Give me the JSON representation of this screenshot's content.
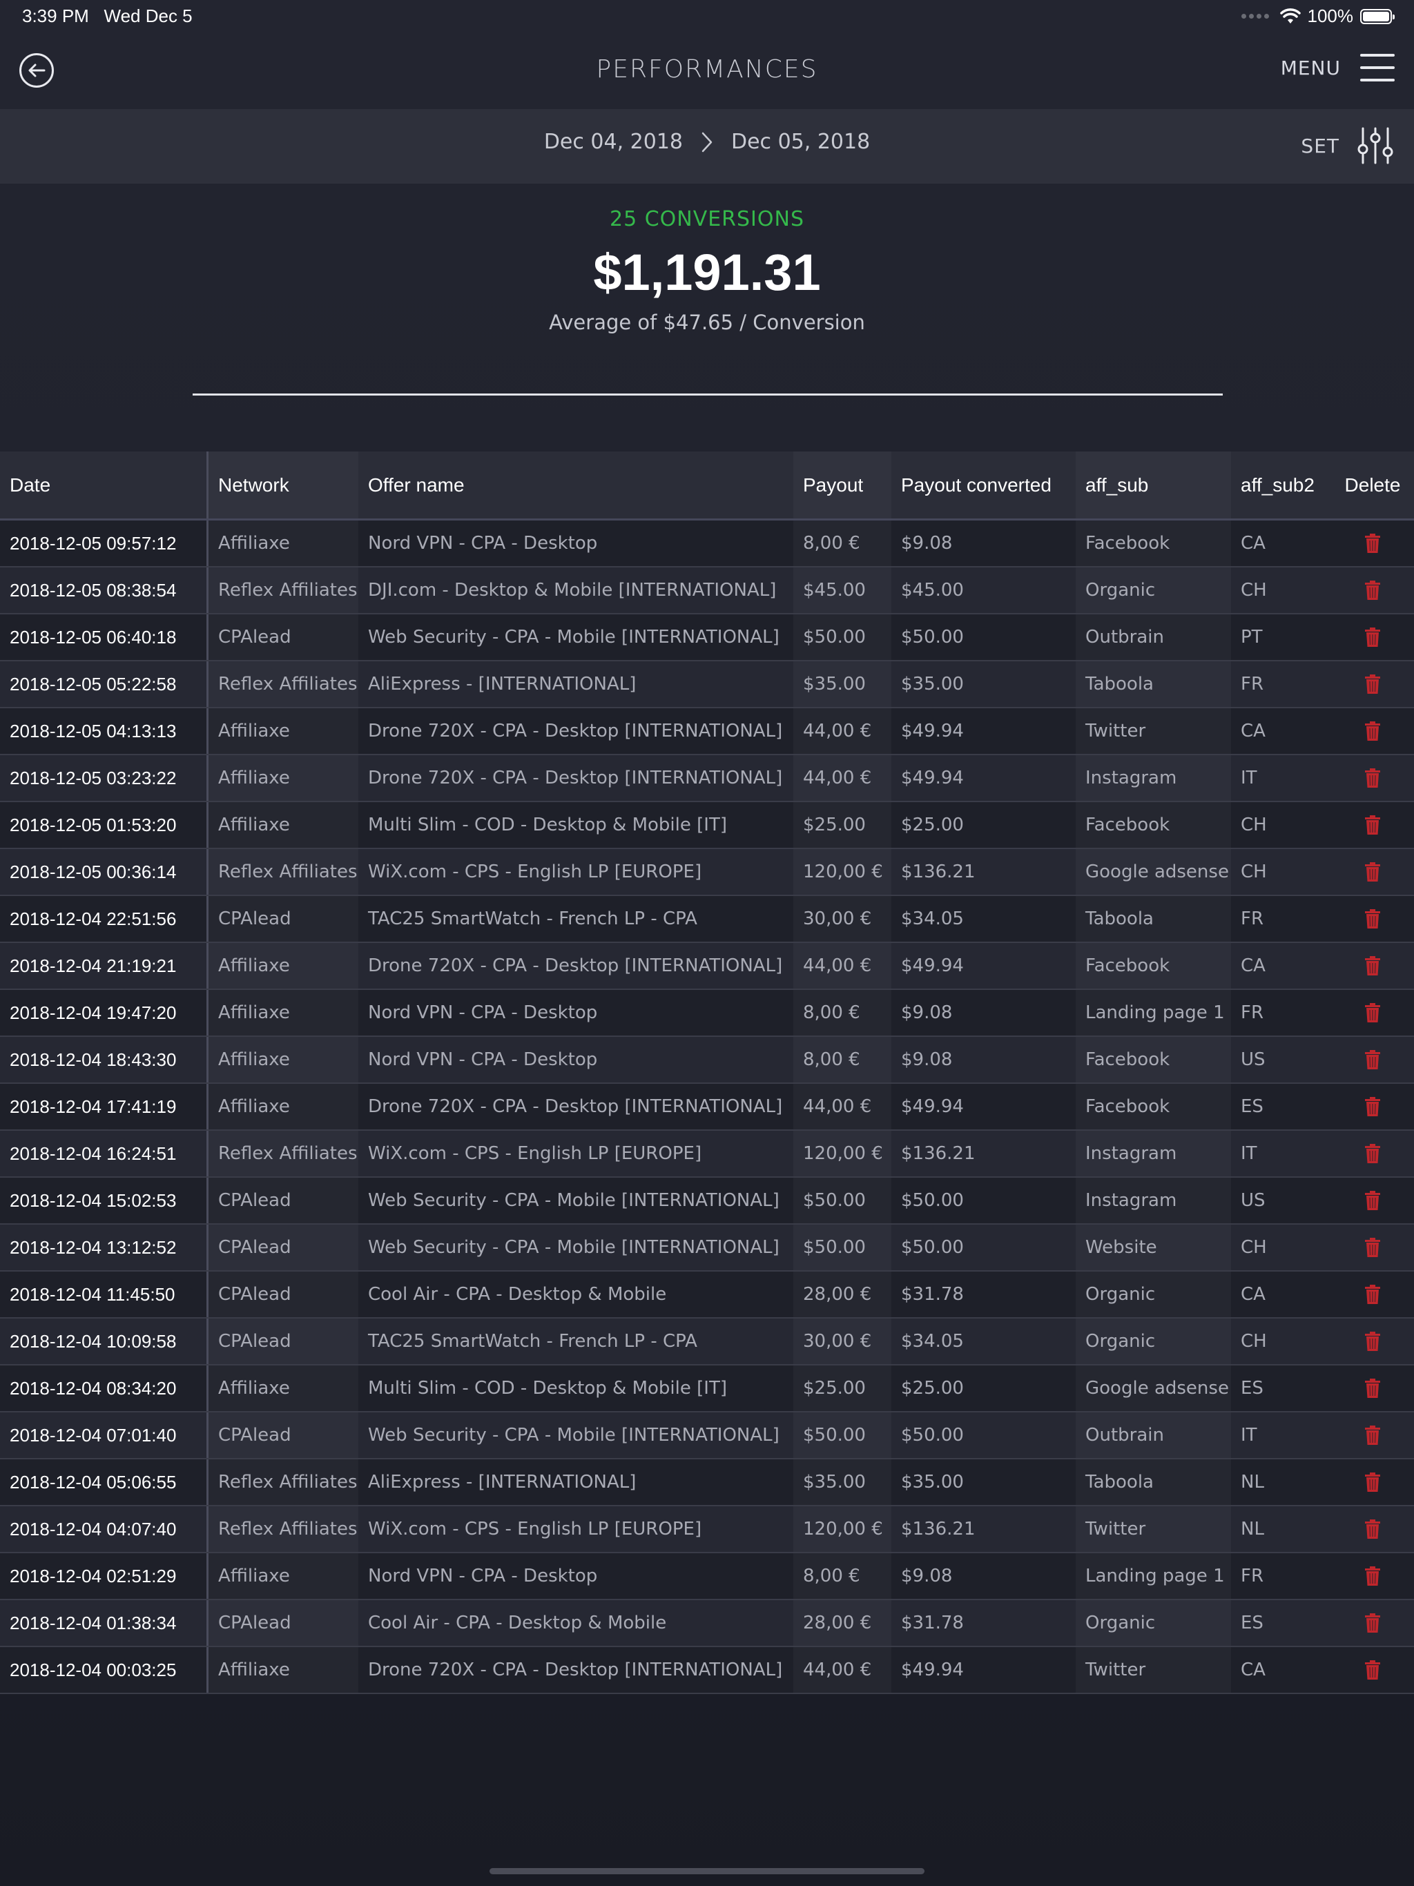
{
  "status": {
    "time": "3:39 PM",
    "date": "Wed Dec 5",
    "battery": "100%"
  },
  "nav": {
    "title": "PERFORMANCES",
    "menu_label": "MENU"
  },
  "datebar": {
    "start_date": "Dec 04, 2018",
    "end_date": "Dec 05, 2018",
    "set_label": "SET"
  },
  "summary": {
    "conversions": "25 CONVERSIONS",
    "total": "$1,191.31",
    "average": "Average of $47.65 / Conversion"
  },
  "colors": {
    "accent_green": "#35b94b",
    "delete_red": "#c0262c"
  },
  "table": {
    "headers": [
      "Date",
      "Network",
      "Offer name",
      "Payout",
      "Payout converted",
      "aff_sub",
      "aff_sub2",
      "Delete"
    ],
    "rows": [
      {
        "date": "2018-12-05 09:57:12",
        "network": "Affiliaxe",
        "offer": "Nord VPN - CPA - Desktop",
        "payout": "8,00 €",
        "converted": "$9.08",
        "aff_sub": "Facebook",
        "aff_sub2": "CA"
      },
      {
        "date": "2018-12-05 08:38:54",
        "network": "Reflex Affiliates",
        "offer": "DJI.com - Desktop & Mobile [INTERNATIONAL]",
        "payout": "$45.00",
        "converted": "$45.00",
        "aff_sub": "Organic",
        "aff_sub2": "CH"
      },
      {
        "date": "2018-12-05 06:40:18",
        "network": "CPAlead",
        "offer": "Web Security - CPA - Mobile [INTERNATIONAL]",
        "payout": "$50.00",
        "converted": "$50.00",
        "aff_sub": "Outbrain",
        "aff_sub2": "PT"
      },
      {
        "date": "2018-12-05 05:22:58",
        "network": "Reflex Affiliates",
        "offer": "AliExpress - [INTERNATIONAL]",
        "payout": "$35.00",
        "converted": "$35.00",
        "aff_sub": "Taboola",
        "aff_sub2": "FR"
      },
      {
        "date": "2018-12-05 04:13:13",
        "network": "Affiliaxe",
        "offer": "Drone 720X - CPA - Desktop [INTERNATIONAL]",
        "payout": "44,00 €",
        "converted": "$49.94",
        "aff_sub": "Twitter",
        "aff_sub2": "CA"
      },
      {
        "date": "2018-12-05 03:23:22",
        "network": "Affiliaxe",
        "offer": "Drone 720X - CPA - Desktop [INTERNATIONAL]",
        "payout": "44,00 €",
        "converted": "$49.94",
        "aff_sub": "Instagram",
        "aff_sub2": "IT"
      },
      {
        "date": "2018-12-05 01:53:20",
        "network": "Affiliaxe",
        "offer": "Multi Slim - COD - Desktop & Mobile [IT]",
        "payout": "$25.00",
        "converted": "$25.00",
        "aff_sub": "Facebook",
        "aff_sub2": "CH"
      },
      {
        "date": "2018-12-05 00:36:14",
        "network": "Reflex Affiliates",
        "offer": "WiX.com - CPS - English LP [EUROPE]",
        "payout": "120,00 €",
        "converted": "$136.21",
        "aff_sub": "Google adsense",
        "aff_sub2": "CH"
      },
      {
        "date": "2018-12-04 22:51:56",
        "network": "CPAlead",
        "offer": "TAC25 SmartWatch - French LP - CPA",
        "payout": "30,00 €",
        "converted": "$34.05",
        "aff_sub": "Taboola",
        "aff_sub2": "FR"
      },
      {
        "date": "2018-12-04 21:19:21",
        "network": "Affiliaxe",
        "offer": "Drone 720X - CPA - Desktop [INTERNATIONAL]",
        "payout": "44,00 €",
        "converted": "$49.94",
        "aff_sub": "Facebook",
        "aff_sub2": "CA"
      },
      {
        "date": "2018-12-04 19:47:20",
        "network": "Affiliaxe",
        "offer": "Nord VPN - CPA - Desktop",
        "payout": "8,00 €",
        "converted": "$9.08",
        "aff_sub": "Landing page 1",
        "aff_sub2": "FR"
      },
      {
        "date": "2018-12-04 18:43:30",
        "network": "Affiliaxe",
        "offer": "Nord VPN - CPA - Desktop",
        "payout": "8,00 €",
        "converted": "$9.08",
        "aff_sub": "Facebook",
        "aff_sub2": "US"
      },
      {
        "date": "2018-12-04 17:41:19",
        "network": "Affiliaxe",
        "offer": "Drone 720X - CPA - Desktop [INTERNATIONAL]",
        "payout": "44,00 €",
        "converted": "$49.94",
        "aff_sub": "Facebook",
        "aff_sub2": "ES"
      },
      {
        "date": "2018-12-04 16:24:51",
        "network": "Reflex Affiliates",
        "offer": "WiX.com - CPS - English LP [EUROPE]",
        "payout": "120,00 €",
        "converted": "$136.21",
        "aff_sub": "Instagram",
        "aff_sub2": "IT"
      },
      {
        "date": "2018-12-04 15:02:53",
        "network": "CPAlead",
        "offer": "Web Security - CPA - Mobile [INTERNATIONAL]",
        "payout": "$50.00",
        "converted": "$50.00",
        "aff_sub": "Instagram",
        "aff_sub2": "US"
      },
      {
        "date": "2018-12-04 13:12:52",
        "network": "CPAlead",
        "offer": "Web Security - CPA - Mobile [INTERNATIONAL]",
        "payout": "$50.00",
        "converted": "$50.00",
        "aff_sub": "Website",
        "aff_sub2": "CH"
      },
      {
        "date": "2018-12-04 11:45:50",
        "network": "CPAlead",
        "offer": "Cool Air - CPA - Desktop & Mobile",
        "payout": "28,00 €",
        "converted": "$31.78",
        "aff_sub": "Organic",
        "aff_sub2": "CA"
      },
      {
        "date": "2018-12-04 10:09:58",
        "network": "CPAlead",
        "offer": "TAC25 SmartWatch - French LP - CPA",
        "payout": "30,00 €",
        "converted": "$34.05",
        "aff_sub": "Organic",
        "aff_sub2": "CH"
      },
      {
        "date": "2018-12-04 08:34:20",
        "network": "Affiliaxe",
        "offer": "Multi Slim - COD - Desktop & Mobile [IT]",
        "payout": "$25.00",
        "converted": "$25.00",
        "aff_sub": "Google adsense",
        "aff_sub2": "ES"
      },
      {
        "date": "2018-12-04 07:01:40",
        "network": "CPAlead",
        "offer": "Web Security - CPA - Mobile [INTERNATIONAL]",
        "payout": "$50.00",
        "converted": "$50.00",
        "aff_sub": "Outbrain",
        "aff_sub2": "IT"
      },
      {
        "date": "2018-12-04 05:06:55",
        "network": "Reflex Affiliates",
        "offer": "AliExpress - [INTERNATIONAL]",
        "payout": "$35.00",
        "converted": "$35.00",
        "aff_sub": "Taboola",
        "aff_sub2": "NL"
      },
      {
        "date": "2018-12-04 04:07:40",
        "network": "Reflex Affiliates",
        "offer": "WiX.com - CPS - English LP [EUROPE]",
        "payout": "120,00 €",
        "converted": "$136.21",
        "aff_sub": "Twitter",
        "aff_sub2": "NL"
      },
      {
        "date": "2018-12-04 02:51:29",
        "network": "Affiliaxe",
        "offer": "Nord VPN - CPA - Desktop",
        "payout": "8,00 €",
        "converted": "$9.08",
        "aff_sub": "Landing page 1",
        "aff_sub2": "FR"
      },
      {
        "date": "2018-12-04 01:38:34",
        "network": "CPAlead",
        "offer": "Cool Air - CPA - Desktop & Mobile",
        "payout": "28,00 €",
        "converted": "$31.78",
        "aff_sub": "Organic",
        "aff_sub2": "ES"
      },
      {
        "date": "2018-12-04 00:03:25",
        "network": "Affiliaxe",
        "offer": "Drone 720X - CPA - Desktop [INTERNATIONAL]",
        "payout": "44,00 €",
        "converted": "$49.94",
        "aff_sub": "Twitter",
        "aff_sub2": "CA"
      }
    ]
  }
}
